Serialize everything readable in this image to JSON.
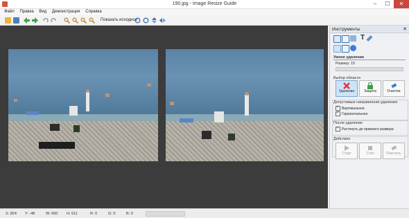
{
  "window": {
    "title": "190.jpg - Image Resize Guide",
    "min": "–",
    "max": "☐",
    "close": "✕"
  },
  "menu": [
    "Файл",
    "Правка",
    "Вид",
    "Демонстрация",
    "Справка"
  ],
  "toolbar": {
    "show_original": "Показать исходное"
  },
  "panel": {
    "title": "Инструменты",
    "close": "✕",
    "section_title": "Умное удаление",
    "size_label": "Размер: 15",
    "area_label": "Выбор области",
    "btn_delete": "Удаление",
    "btn_protect": "Защита",
    "btn_clear": "Очистка",
    "directions_label": "Допустимые направления удаления",
    "vertical": "Вертикальное",
    "horizontal": "Горизонтальное",
    "after_label": "После удаления",
    "stretch": "Растянуть до прежнего размера",
    "actions_label": "Действия",
    "start": "Старт",
    "stop": "Стоп",
    "clear": "Очистить"
  },
  "status": {
    "x": "X: 824",
    "y": "Y: -48",
    "w": "W: 660",
    "h": "H: 511",
    "r": "R: 0",
    "g": "G: 0",
    "b": "B: 0"
  },
  "colors": {
    "delete_accent": "#d43b3b",
    "protect_accent": "#3aa14a",
    "clear_accent": "#3b7dd8",
    "canvas_bg": "#3c3c3c"
  }
}
